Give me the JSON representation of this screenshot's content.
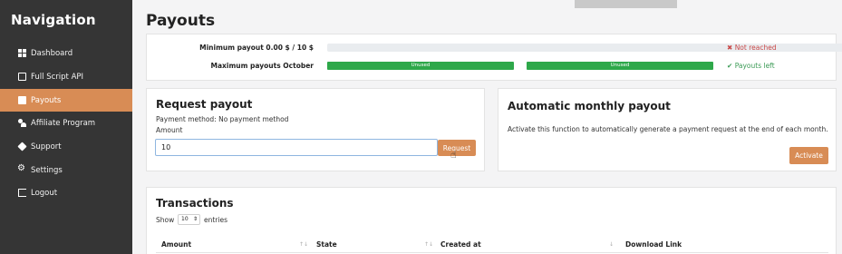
{
  "sidebar": {
    "title": "Navigation",
    "items": [
      {
        "label": "Dashboard",
        "icon": "dashboard-icon"
      },
      {
        "label": "Full Script API",
        "icon": "file-icon"
      },
      {
        "label": "Payouts",
        "icon": "wallet-icon"
      },
      {
        "label": "Affiliate Program",
        "icon": "users-icon"
      },
      {
        "label": "Support",
        "icon": "tag-icon"
      },
      {
        "label": "Settings",
        "icon": "cogs-icon"
      },
      {
        "label": "Logout",
        "icon": "logout-icon"
      }
    ],
    "active_index": 2
  },
  "page": {
    "title": "Payouts"
  },
  "progress": {
    "min_label": "Minimum payout 0.00 $ / 10 $",
    "min_progress": 0,
    "min_status": "Not reached",
    "max_label": "Maximum payouts October",
    "max_slots": [
      "Unused",
      "Unused"
    ],
    "max_status": "Payouts left"
  },
  "request": {
    "title": "Request payout",
    "method": "Payment method: No payment method",
    "amount_label": "Amount",
    "amount_value": "10",
    "button": "Request"
  },
  "auto": {
    "title": "Automatic monthly payout",
    "description": "Activate this function to automatically generate a payment request at the end of each month.",
    "button": "Activate"
  },
  "transactions": {
    "title": "Transactions",
    "show_label": "Show",
    "entries_value": "10",
    "entries_label": "entries",
    "columns": [
      "Amount",
      "State",
      "Created at",
      "Download Link"
    ]
  },
  "colors": {
    "accent": "#d88c55",
    "sidebar": "#353535",
    "success": "#2ea84a",
    "danger": "#c94a4a"
  }
}
